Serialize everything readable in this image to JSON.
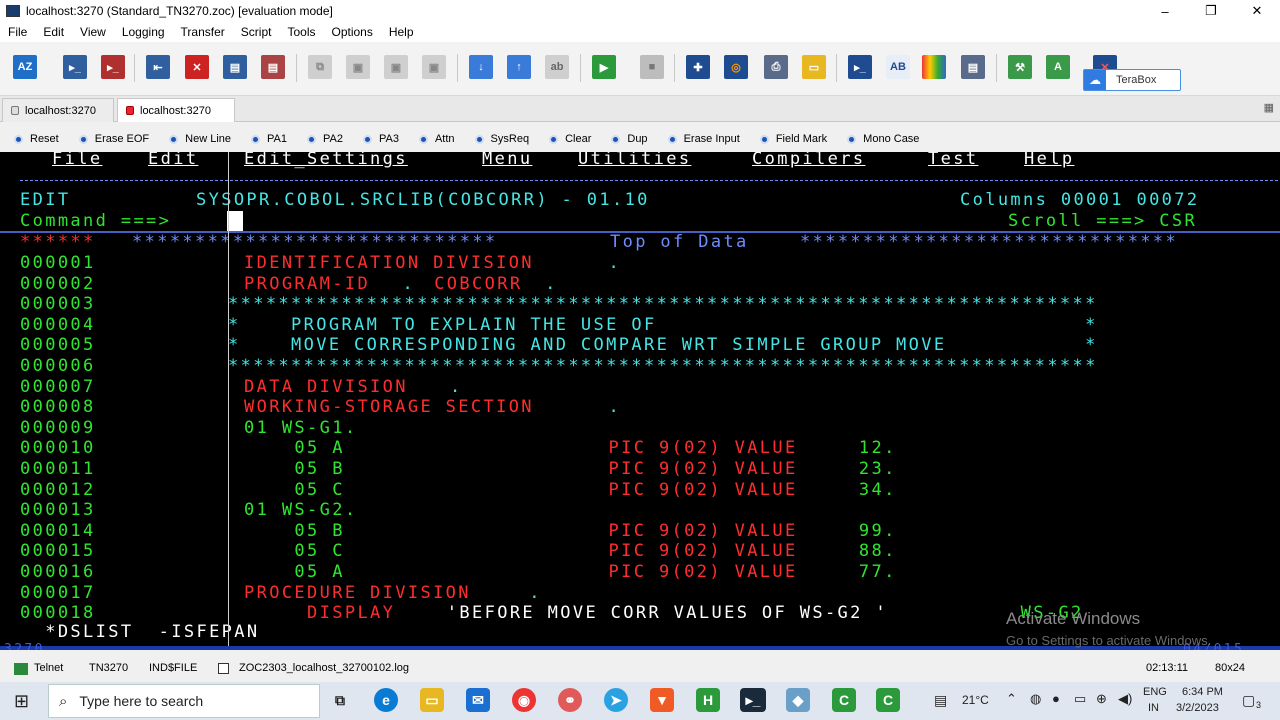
{
  "window": {
    "title": "localhost:3270 (Standard_TN3270.zoc) [evaluation mode]",
    "min": "–",
    "max": "❐",
    "close": "✕"
  },
  "menu": [
    "File",
    "Edit",
    "View",
    "Logging",
    "Transfer",
    "Script",
    "Tools",
    "Options",
    "Help"
  ],
  "terabox": {
    "label": "TeraBox"
  },
  "tabs": [
    {
      "label": "localhost:3270"
    },
    {
      "label": "localhost:3270"
    }
  ],
  "fkeys": [
    "Reset",
    "Erase EOF",
    "New Line",
    "PA1",
    "PA2",
    "PA3",
    "Attn",
    "SysReq",
    "Clear",
    "Dup",
    "Erase Input",
    "Field Mark",
    "Mono Case"
  ],
  "terminal": {
    "menubar": [
      "File",
      "Edit",
      "Edit_Settings",
      "Menu",
      "Utilities",
      "Compilers",
      "Test",
      "Help"
    ],
    "edit_label": "EDIT",
    "dataset": "SYSOPR.COBOL.SRCLIB(COBCORR) - 01.10",
    "columns": "Columns 00001 00072",
    "command_label": "Command ===>",
    "scroll": "Scroll ===> CSR",
    "top_prefix": "******",
    "top_left_stars": "*****************************",
    "top_of_data": "Top of Data",
    "top_right_stars": "******************************",
    "lines": [
      {
        "num": "000001",
        "segs": [
          {
            "t": "IDENTIFICATION DIVISION",
            "c": "red"
          },
          {
            "t": ".",
            "c": "cyan"
          }
        ]
      },
      {
        "num": "000002",
        "segs": [
          {
            "t": "PROGRAM-ID",
            "c": "red"
          },
          {
            "t": ". ",
            "c": "cyan"
          },
          {
            "t": "COBCORR",
            "c": "red"
          },
          {
            "t": ".",
            "c": "cyan"
          }
        ]
      },
      {
        "num": "000003",
        "comment": "*********************************************************************"
      },
      {
        "num": "000004",
        "comment": "*    PROGRAM TO EXPLAIN THE USE OF                                  *"
      },
      {
        "num": "000005",
        "comment": "*    MOVE CORRESPONDING AND COMPARE WRT SIMPLE GROUP MOVE           *"
      },
      {
        "num": "000006",
        "comment": "*********************************************************************"
      },
      {
        "num": "000007",
        "segs": [
          {
            "t": "DATA DIVISION",
            "c": "red"
          },
          {
            "t": ".",
            "c": "cyan"
          }
        ]
      },
      {
        "num": "000008",
        "segs": [
          {
            "t": "WORKING-STORAGE SECTION",
            "c": "red"
          },
          {
            "t": ".",
            "c": "cyan"
          }
        ]
      },
      {
        "num": "000009",
        "segs": [
          {
            "t": "01 WS-G1.",
            "c": "green"
          }
        ]
      },
      {
        "num": "000010",
        "segs": [
          {
            "t": "    05 A               ",
            "c": "green"
          },
          {
            "t": "PIC 9(02) VALUE",
            "c": "red"
          },
          {
            "t": " 12.",
            "c": "green"
          }
        ]
      },
      {
        "num": "000011",
        "segs": [
          {
            "t": "    05 B               ",
            "c": "green"
          },
          {
            "t": "PIC 9(02) VALUE",
            "c": "red"
          },
          {
            "t": " 23.",
            "c": "green"
          }
        ]
      },
      {
        "num": "000012",
        "segs": [
          {
            "t": "    05 C               ",
            "c": "green"
          },
          {
            "t": "PIC 9(02) VALUE",
            "c": "red"
          },
          {
            "t": " 34.",
            "c": "green"
          }
        ]
      },
      {
        "num": "000013",
        "segs": [
          {
            "t": "01 WS-G2.",
            "c": "green"
          }
        ]
      },
      {
        "num": "000014",
        "segs": [
          {
            "t": "    05 B               ",
            "c": "green"
          },
          {
            "t": "PIC 9(02) VALUE",
            "c": "red"
          },
          {
            "t": " 99.",
            "c": "green"
          }
        ]
      },
      {
        "num": "000015",
        "segs": [
          {
            "t": "    05 C               ",
            "c": "green"
          },
          {
            "t": "PIC 9(02) VALUE",
            "c": "red"
          },
          {
            "t": " 88.",
            "c": "green"
          }
        ]
      },
      {
        "num": "000016",
        "segs": [
          {
            "t": "    05 A               ",
            "c": "green"
          },
          {
            "t": "PIC 9(02) VALUE",
            "c": "red"
          },
          {
            "t": " 77.",
            "c": "green"
          }
        ]
      },
      {
        "num": "000017",
        "segs": [
          {
            "t": "PROCEDURE DIVISION",
            "c": "red"
          },
          {
            "t": ".",
            "c": "cyan"
          }
        ]
      },
      {
        "num": "000018",
        "segs": [
          {
            "t": "     DISPLAY",
            "c": "red"
          },
          {
            "t": " 'BEFORE MOVE CORR VALUES OF WS-G2 ' ",
            "c": "white"
          },
          {
            "t": "WS-G2",
            "c": "green"
          }
        ]
      }
    ],
    "bottom_cmd": "  *DSLIST  -ISFEPAN",
    "oia_left": "3270",
    "oia_right": "04/015",
    "watermark_title": "Activate Windows",
    "watermark_sub": "Go to Settings to activate Windows."
  },
  "status": {
    "protocol": "Telnet",
    "emulation": "TN3270",
    "file": "IND$FILE",
    "log": "ZOC2303_localhost_32700102.log",
    "time": "02:13:11",
    "size": "80x24"
  },
  "taskbar": {
    "search_placeholder": "Type here to search",
    "weather": "21°C",
    "lang": "ENG",
    "region": "IN",
    "clock_time": "6:34 PM",
    "clock_date": "3/2/2023",
    "notif_count": "3"
  },
  "colors": {
    "green": "#2fe52f",
    "red": "#ff2d2d",
    "blue": "#6f8cff",
    "cyan": "#45e5e5",
    "terminal_bg": "#000000"
  }
}
